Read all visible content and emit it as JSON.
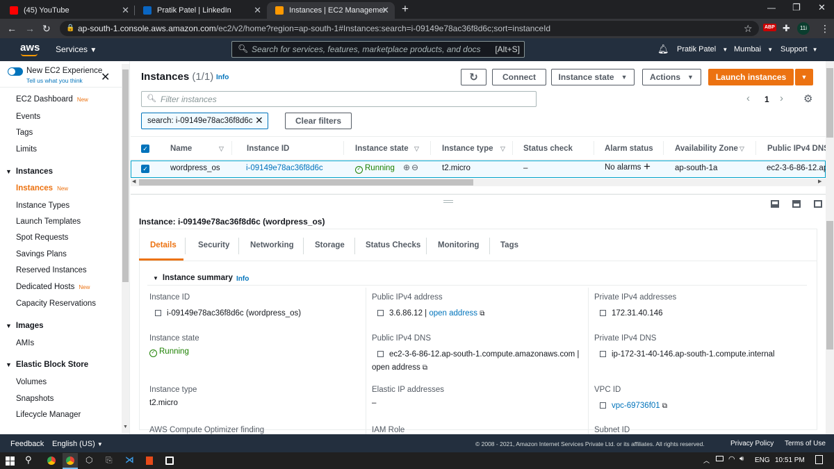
{
  "browser": {
    "tabs": [
      {
        "title": "(45) YouTube"
      },
      {
        "title": "Pratik Patel | LinkedIn"
      },
      {
        "title": "Instances | EC2 Management Cor"
      }
    ],
    "url_host": "ap-south-1.console.aws.amazon.com",
    "url_path": "/ec2/v2/home?region=ap-south-1#Instances:search=i-09149e78ac36f8d6c;sort=instanceId",
    "ext_abp": "ABP",
    "ext_user": "11i"
  },
  "header": {
    "logo": "aws",
    "services": "Services",
    "search_placeholder": "Search for services, features, marketplace products, and docs",
    "search_shortcut": "[Alt+S]",
    "user": "Pratik Patel",
    "region": "Mumbai",
    "support": "Support"
  },
  "sidebar": {
    "new_exp_title": "New EC2 Experience",
    "new_exp_sub": "Tell us what you think",
    "new_badge": "New",
    "top": [
      "EC2 Dashboard",
      "Events",
      "Tags",
      "Limits"
    ],
    "instances_section": "Instances",
    "instances_items": [
      "Instances",
      "Instance Types",
      "Launch Templates",
      "Spot Requests",
      "Savings Plans",
      "Reserved Instances",
      "Dedicated Hosts",
      "Capacity Reservations"
    ],
    "images_section": "Images",
    "images_items": [
      "AMIs"
    ],
    "ebs_section": "Elastic Block Store",
    "ebs_items": [
      "Volumes",
      "Snapshots",
      "Lifecycle Manager"
    ]
  },
  "main": {
    "title": "Instances",
    "count": "(1/1)",
    "info": "Info",
    "connect": "Connect",
    "instance_state_btn": "Instance state",
    "actions_btn": "Actions",
    "launch_btn": "Launch instances",
    "filter_placeholder": "Filter instances",
    "page": "1",
    "filter_chip": "search: i-09149e78ac36f8d6c",
    "clear_filters": "Clear filters",
    "columns": [
      "Name",
      "Instance ID",
      "Instance state",
      "Instance type",
      "Status check",
      "Alarm status",
      "Availability Zone",
      "Public IPv4 DNS"
    ],
    "row": {
      "name": "wordpress_os",
      "id": "i-09149e78ac36f8d6c",
      "state": "Running",
      "type": "t2.micro",
      "status_check": "–",
      "alarm": "No alarms",
      "az": "ap-south-1a",
      "dns": "ec2-3-6-86-12.ap"
    }
  },
  "detail": {
    "heading": "Instance: i-09149e78ac36f8d6c (wordpress_os)",
    "tabs": [
      "Details",
      "Security",
      "Networking",
      "Storage",
      "Status Checks",
      "Monitoring",
      "Tags"
    ],
    "summary": "Instance summary",
    "info": "Info",
    "instance_id_label": "Instance ID",
    "instance_id_value": "i-09149e78ac36f8d6c (wordpress_os)",
    "public_ip_label": "Public IPv4 address",
    "public_ip_value": "3.6.86.12",
    "open_address": "open address",
    "private_ips_label": "Private IPv4 addresses",
    "private_ip_value": "172.31.40.146",
    "state_label": "Instance state",
    "state_value": "Running",
    "public_dns_label": "Public IPv4 DNS",
    "public_dns_value": "ec2-3-6-86-12.ap-south-1.compute.amazonaws.com",
    "private_dns_label": "Private IPv4 DNS",
    "private_dns_value": "ip-172-31-40-146.ap-south-1.compute.internal",
    "type_label": "Instance type",
    "type_value": "t2.micro",
    "eip_label": "Elastic IP addresses",
    "eip_value": "–",
    "vpc_label": "VPC ID",
    "vpc_value": "vpc-69736f01",
    "optimizer_label": "AWS Compute Optimizer finding",
    "iam_label": "IAM Role",
    "subnet_label": "Subnet ID"
  },
  "footer": {
    "feedback": "Feedback",
    "language": "English (US)",
    "copyright": "© 2008 - 2021, Amazon Internet Services Private Ltd. or its affiliates. All rights reserved.",
    "privacy": "Privacy Policy",
    "terms": "Terms of Use"
  },
  "taskbar": {
    "lang": "ENG",
    "time": "10:51 PM"
  },
  "colors": {
    "aws_nav": "#232f3e",
    "accent_orange": "#ec7211",
    "link_blue": "#0073bb",
    "running_green": "#1d8102"
  }
}
